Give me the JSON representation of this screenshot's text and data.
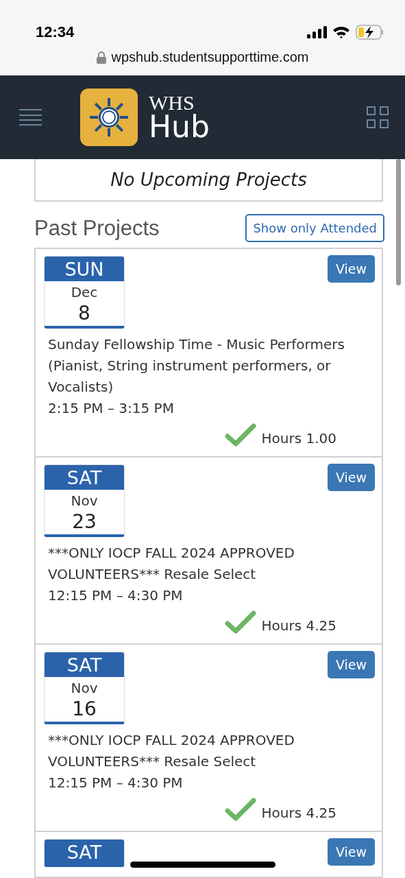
{
  "status_bar": {
    "time": "12:34",
    "url": "wpshub.studentsupporttime.com"
  },
  "header": {
    "logo_top": "WHS",
    "logo_bottom": "Hub"
  },
  "upcoming": {
    "message": "No Upcoming Projects"
  },
  "past": {
    "title": "Past Projects",
    "filter_button": "Show only Attended"
  },
  "projects": [
    {
      "weekday": "SUN",
      "month": "Dec",
      "day": "8",
      "title": "Sunday Fellowship Time - Music Performers (Pianist, String instrument performers, or Vocalists)",
      "time": "2:15 PM – 3:15 PM",
      "attended": true,
      "hours": "Hours 1.00",
      "button": "View"
    },
    {
      "weekday": "SAT",
      "month": "Nov",
      "day": "23",
      "title": "***ONLY IOCP FALL 2024 APPROVED VOLUNTEERS*** Resale Select",
      "time": "12:15 PM – 4:30 PM",
      "attended": true,
      "hours": "Hours 4.25",
      "button": "View"
    },
    {
      "weekday": "SAT",
      "month": "Nov",
      "day": "16",
      "title": "***ONLY IOCP FALL 2024 APPROVED VOLUNTEERS*** Resale Select",
      "time": "12:15 PM – 4:30 PM",
      "attended": true,
      "hours": "Hours 4.25",
      "button": "View"
    },
    {
      "weekday": "SAT",
      "button": "View"
    }
  ]
}
